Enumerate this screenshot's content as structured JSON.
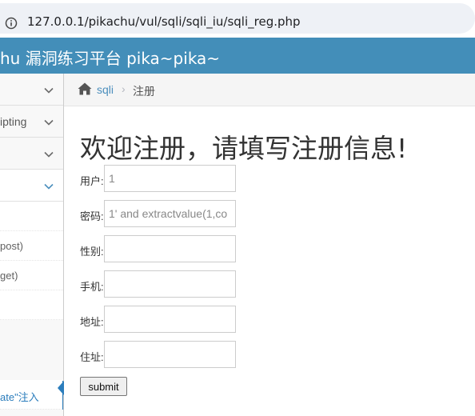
{
  "browser": {
    "url": "127.0.0.1/pikachu/vul/sqli/sqli_iu/sqli_reg.php",
    "icons": {
      "info": "info-circle-icon"
    }
  },
  "header": {
    "title": "hu 漏洞练习平台 pika~pika~",
    "bg_color": "#438eb9"
  },
  "sidebar": {
    "items": [
      {
        "label": ""
      },
      {
        "label": "ipting"
      },
      {
        "label": ""
      },
      {
        "label": ""
      }
    ],
    "subitems": [
      {
        "label": ""
      },
      {
        "label": "post)"
      },
      {
        "label": "get)"
      },
      {
        "label": ""
      },
      {
        "label": "ate\"注入"
      }
    ],
    "accent_color": "#2b7dbc"
  },
  "breadcrumb": {
    "home_icon": "home-icon",
    "link": "sqli",
    "separator": "›",
    "current": "注册"
  },
  "main": {
    "title": "欢迎注册，请填写注册信息!",
    "fields": [
      {
        "label": "用户:",
        "value": "1"
      },
      {
        "label": "密码:",
        "value": "1' and extractvalue(1,co"
      },
      {
        "label": "性别:",
        "value": ""
      },
      {
        "label": "手机:",
        "value": ""
      },
      {
        "label": "地址:",
        "value": ""
      },
      {
        "label": "住址:",
        "value": ""
      }
    ],
    "submit_label": "submit"
  }
}
